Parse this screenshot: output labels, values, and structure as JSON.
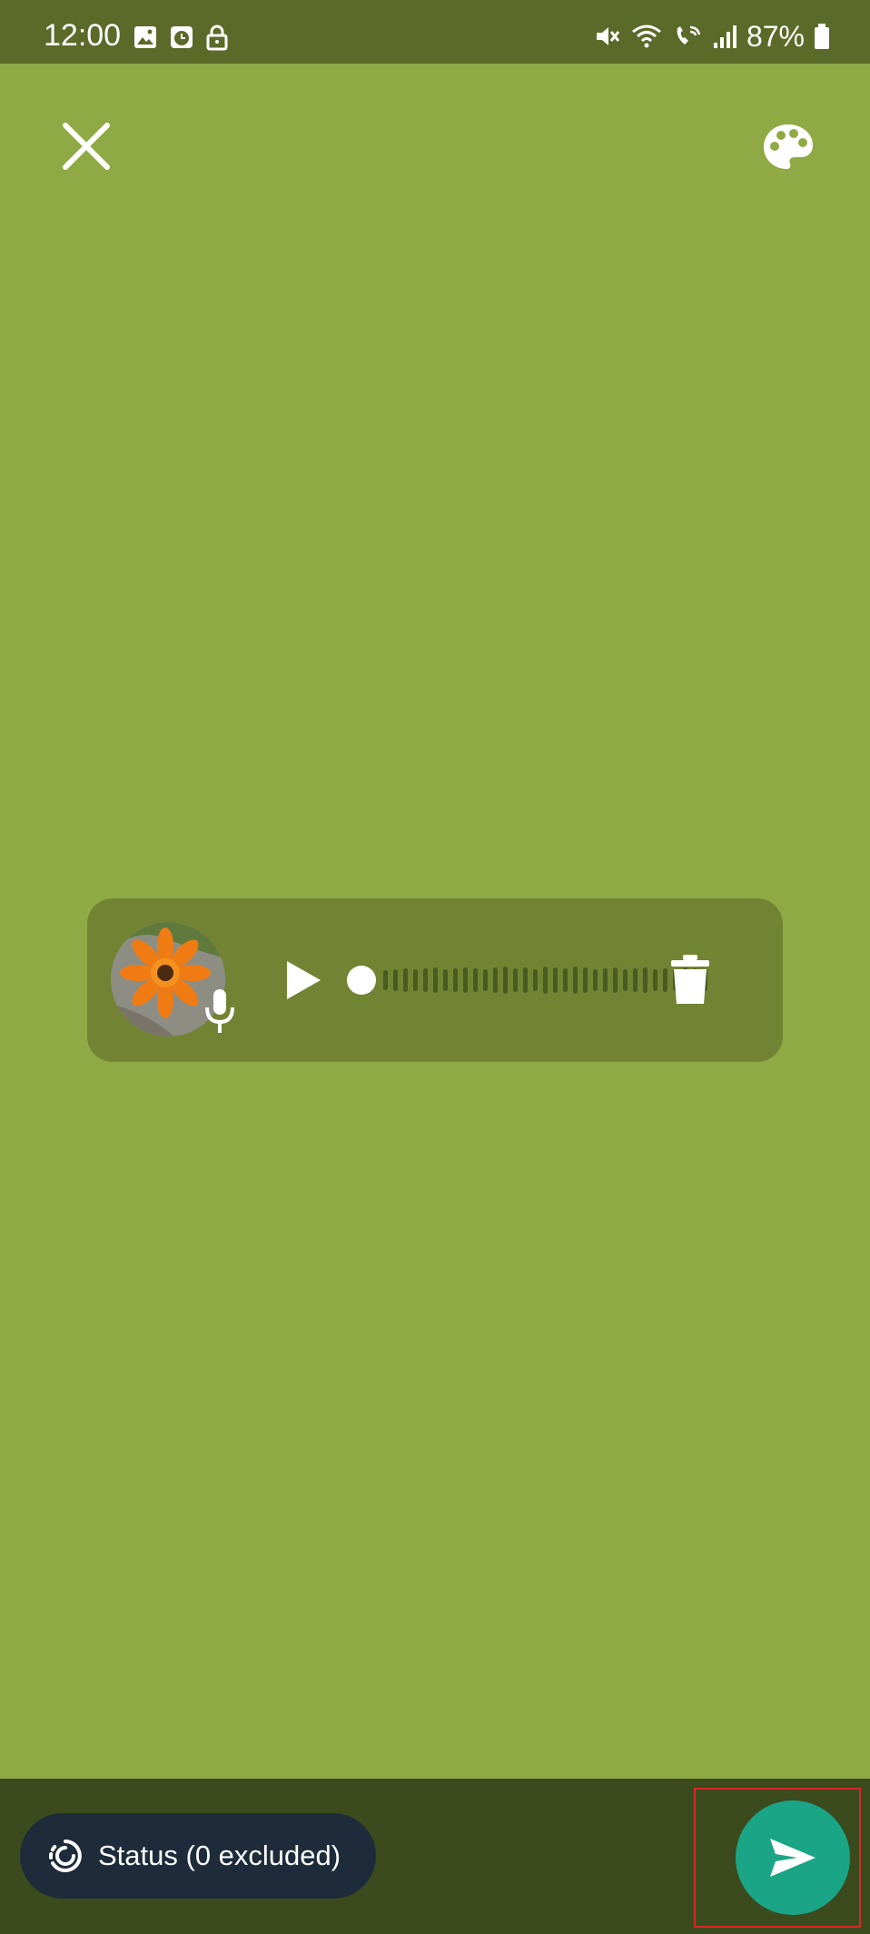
{
  "status_bar": {
    "time": "12:00",
    "battery_percent": "87%",
    "left_icons": [
      "gallery-icon",
      "clock-app-icon",
      "lock-icon"
    ],
    "right_icons": [
      "mute-icon",
      "wifi-icon",
      "wifi-call-icon",
      "signal-icon",
      "battery-icon"
    ]
  },
  "top_controls": {
    "close_icon": "close-icon",
    "palette_icon": "palette-icon"
  },
  "voice_status": {
    "avatar": "flower-avatar",
    "play_icon": "play-icon",
    "progress": 0,
    "delete_icon": "trash-icon"
  },
  "bottom_bar": {
    "status_chip_label": "Status (0 excluded)",
    "status_chip_icon": "status-icon",
    "send_icon": "send-icon"
  },
  "colors": {
    "background": "#8faa44",
    "status_bar": "#5b6a29",
    "voice_card": "#728434",
    "bottom_bar": "#3c4b1e",
    "chip": "#1d2b3a",
    "send_button": "#1aa586",
    "highlight": "#d22b2b"
  }
}
